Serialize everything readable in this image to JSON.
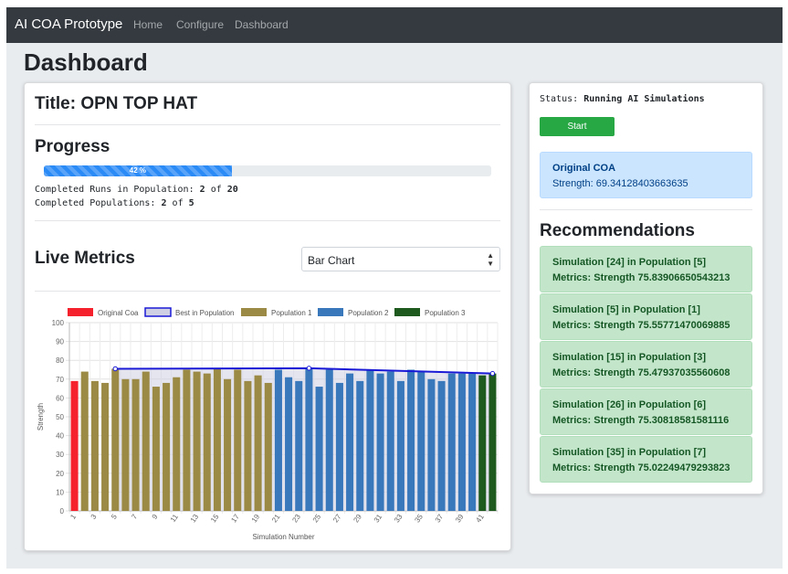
{
  "navbar": {
    "brand": "AI COA Prototype",
    "links": [
      "Home",
      "Configure",
      "Dashboard"
    ]
  },
  "page_title": "Dashboard",
  "left": {
    "title": "Title: OPN TOP HAT",
    "progress_heading": "Progress",
    "progress_percent": 42,
    "progress_label": "42 %",
    "runs": {
      "label": "Completed Runs in Population:",
      "done": "2",
      "of": "of",
      "total": "20"
    },
    "populations": {
      "label": "Completed Populations:",
      "done": "2",
      "of": "of",
      "total": "5"
    },
    "live_metrics_heading": "Live Metrics",
    "chart_select_value": "Bar Chart"
  },
  "right": {
    "status_label": "Status:",
    "status_value": "Running AI Simulations",
    "start_label": "Start",
    "original": {
      "title": "Original COA",
      "strength": "Strength: 69.34128403663635"
    },
    "recommendations_heading": "Recommendations",
    "recommendations": [
      {
        "title": "Simulation [24] in Population [5]",
        "metrics": "Metrics: Strength 75.83906650543213"
      },
      {
        "title": "Simulation [5] in Population [1]",
        "metrics": "Metrics: Strength 75.55771470069885"
      },
      {
        "title": "Simulation [15] in Population [3]",
        "metrics": "Metrics: Strength 75.47937035560608"
      },
      {
        "title": "Simulation [26] in Population [6]",
        "metrics": "Metrics: Strength 75.30818581581116"
      },
      {
        "title": "Simulation [35] in Population [7]",
        "metrics": "Metrics: Strength 75.02249479293823"
      }
    ]
  },
  "colors": {
    "original": "#f5222d",
    "best_line": "#1a1ad6",
    "best_fill": "#d0d0e4",
    "pop1": "#9b8a45",
    "pop2": "#3a78bc",
    "pop3": "#1e5a1e"
  },
  "chart_data": {
    "type": "bar",
    "xlabel": "Simulation Number",
    "ylabel": "Strength",
    "ylim": [
      0,
      100
    ],
    "yticks": [
      0,
      10,
      20,
      30,
      40,
      50,
      60,
      70,
      80,
      90,
      100
    ],
    "legend_position": "top",
    "legend": [
      "Original Coa",
      "Best in Population",
      "Population 1",
      "Population 2",
      "Population 3"
    ],
    "x": [
      1,
      2,
      3,
      4,
      5,
      6,
      7,
      8,
      9,
      10,
      11,
      12,
      13,
      14,
      15,
      16,
      17,
      18,
      19,
      20,
      21,
      22,
      23,
      24,
      25,
      26,
      27,
      28,
      29,
      30,
      31,
      32,
      33,
      34,
      35,
      36,
      37,
      38,
      39,
      40,
      41,
      42
    ],
    "x_tick_labels": [
      "1",
      "3",
      "5",
      "7",
      "9",
      "11",
      "13",
      "15",
      "17",
      "19",
      "21",
      "23",
      "25",
      "27",
      "29",
      "31",
      "33",
      "35",
      "37",
      "39",
      "41"
    ],
    "series": [
      {
        "name": "Original Coa",
        "x": [
          1
        ],
        "values": [
          69
        ]
      },
      {
        "name": "Population 1",
        "x": [
          2,
          3,
          4,
          5,
          6,
          7,
          8,
          9,
          10,
          11,
          12,
          13,
          14,
          15,
          16,
          17,
          18,
          19,
          20
        ],
        "values": [
          74,
          69,
          68,
          75.5,
          70,
          70,
          74,
          66,
          68,
          71,
          75,
          74,
          73,
          75.5,
          70,
          75,
          69,
          72,
          68
        ]
      },
      {
        "name": "Population 2",
        "x": [
          21,
          22,
          23,
          24,
          25,
          26,
          27,
          28,
          29,
          30,
          31,
          32,
          33,
          34,
          35,
          36,
          37,
          38,
          39,
          40
        ],
        "values": [
          75,
          71,
          69,
          75.8,
          66,
          75,
          68,
          73,
          69,
          75,
          73,
          74,
          69,
          75,
          74,
          70,
          69,
          73,
          73,
          73.5
        ]
      },
      {
        "name": "Population 3",
        "x": [
          41,
          42
        ],
        "values": [
          72,
          73
        ]
      },
      {
        "name": "Best in Population",
        "type": "line",
        "x": [
          5,
          24,
          42
        ],
        "values": [
          75.5,
          75.8,
          73
        ]
      }
    ]
  }
}
